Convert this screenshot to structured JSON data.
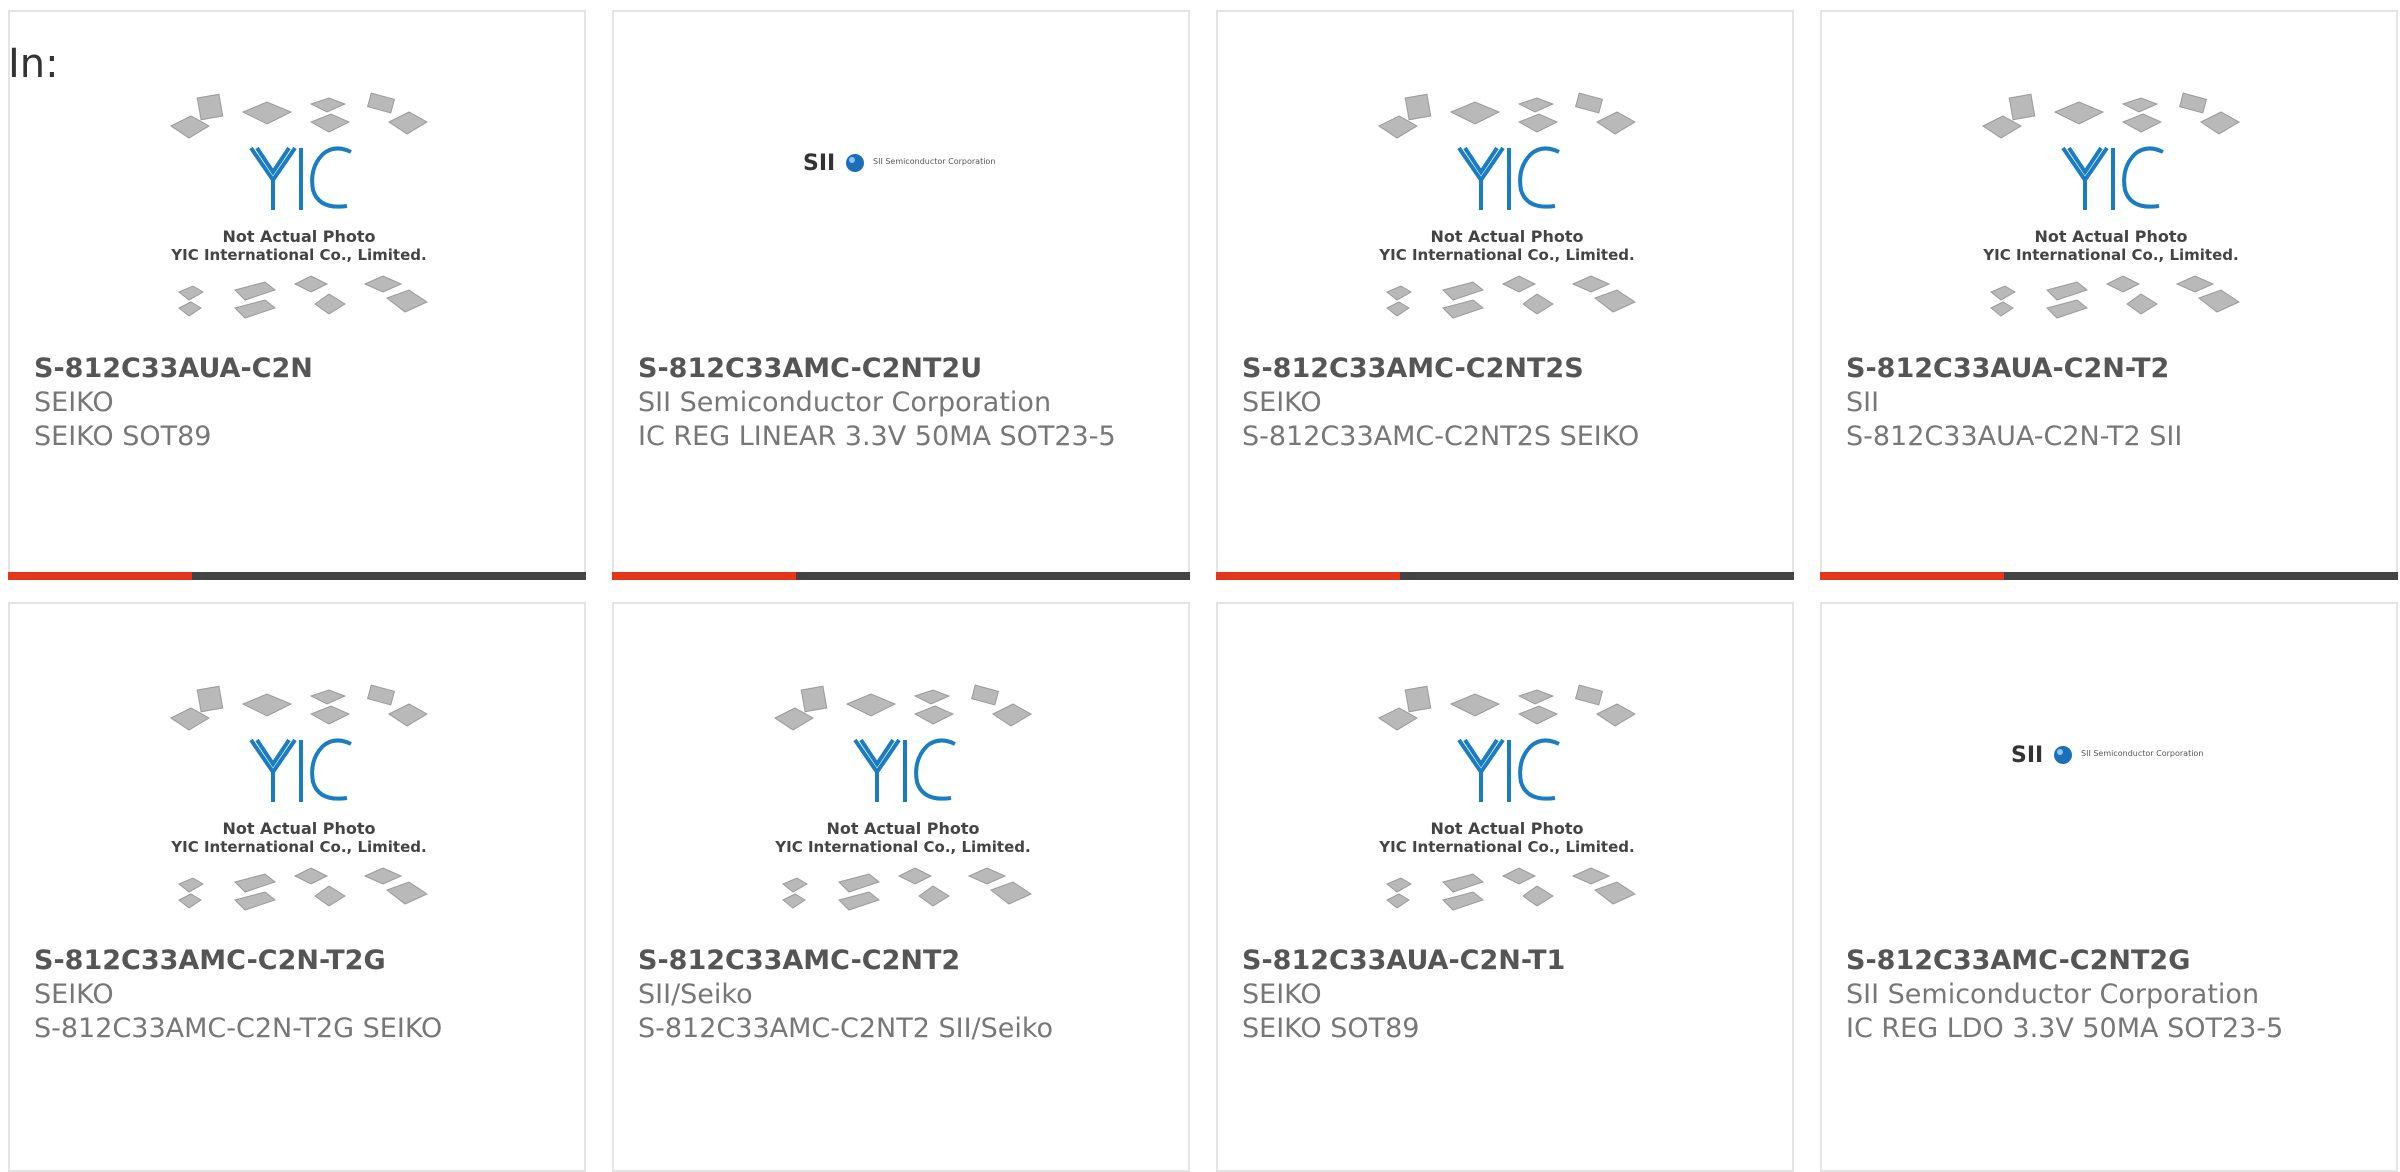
{
  "header": {
    "label": "In:"
  },
  "placeholder": {
    "brand": "YIC",
    "line1": "Not Actual Photo",
    "line2": "YIC International Co., Limited."
  },
  "sii_logo": {
    "mark": "SII",
    "tagline": "SII Semiconductor Corporation"
  },
  "colors": {
    "accent": "#e4361a",
    "bar": "#444444",
    "yic_blue": "#1a7cc1"
  },
  "products": [
    {
      "part": "S-812C33AUA-C2N",
      "maker": "SEIKO",
      "desc": "SEIKO SOT89",
      "image": "yic-placeholder"
    },
    {
      "part": "S-812C33AMC-C2NT2U",
      "maker": "SII Semiconductor Corporation",
      "desc": "IC REG LINEAR 3.3V 50MA SOT23-5",
      "image": "sii-logo"
    },
    {
      "part": "S-812C33AMC-C2NT2S",
      "maker": "SEIKO",
      "desc": "S-812C33AMC-C2NT2S SEIKO",
      "image": "yic-placeholder"
    },
    {
      "part": "S-812C33AUA-C2N-T2",
      "maker": "SII",
      "desc": "S-812C33AUA-C2N-T2 SII",
      "image": "yic-placeholder"
    },
    {
      "part": "S-812C33AMC-C2N-T2G",
      "maker": "SEIKO",
      "desc": "S-812C33AMC-C2N-T2G SEIKO",
      "image": "yic-placeholder"
    },
    {
      "part": "S-812C33AMC-C2NT2",
      "maker": "SII/Seiko",
      "desc": "S-812C33AMC-C2NT2 SII/Seiko",
      "image": "yic-placeholder"
    },
    {
      "part": "S-812C33AUA-C2N-T1",
      "maker": "SEIKO",
      "desc": "SEIKO SOT89",
      "image": "yic-placeholder"
    },
    {
      "part": "S-812C33AMC-C2NT2G",
      "maker": "SII Semiconductor Corporation",
      "desc": "IC REG LDO 3.3V 50MA SOT23-5",
      "image": "sii-logo"
    }
  ]
}
